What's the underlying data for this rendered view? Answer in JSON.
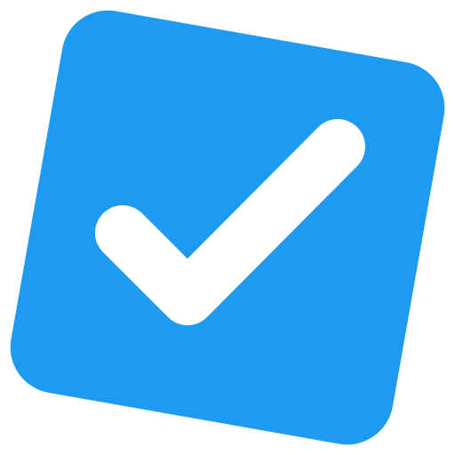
{
  "icon": {
    "name": "checkbox-checked-icon",
    "state": "checked",
    "colors": {
      "fill": "#1E9AF1",
      "check": "#FFFFFF",
      "background": "#FFFFFF"
    }
  }
}
